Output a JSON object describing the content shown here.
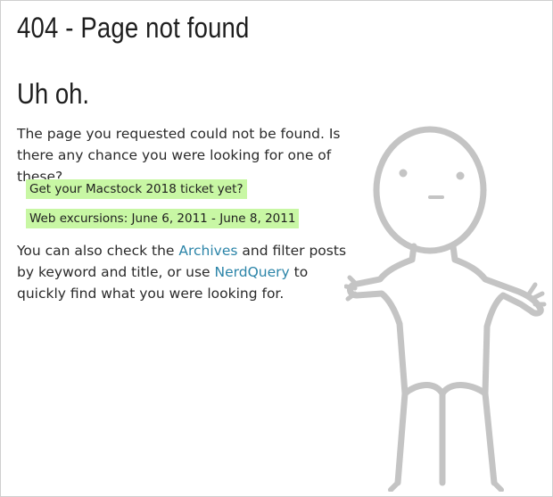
{
  "page": {
    "title": "404 - Page not found",
    "heading": "Uh oh.",
    "intro": "The page you requested could not be found. Is there any chance you were looking for one of these?",
    "suggestions": [
      "Get your Macstock 2018 ticket yet?",
      "Web excursions: June 6, 2011 - June 8, 2011"
    ],
    "outro": {
      "before": "You can also check the ",
      "archives_link": "Archives",
      "middle": " and filter posts by keyword and title, or use ",
      "nerdquery_link": "NerdQuery",
      "after": " to quickly find what you were looking for."
    }
  },
  "colors": {
    "highlight": "#c8f7a4",
    "link": "#2b84a8",
    "illustration": "#c4c4c4"
  },
  "illustration": {
    "icon": "shrugging-person-icon"
  }
}
